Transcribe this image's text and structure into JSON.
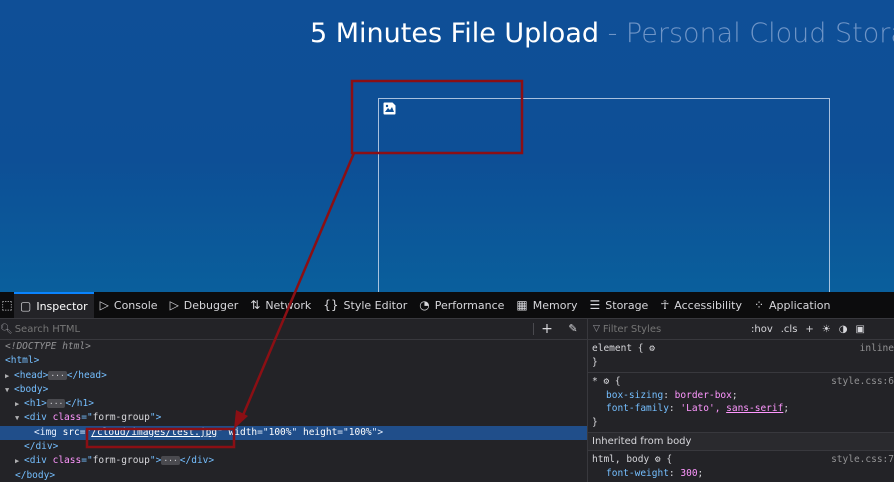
{
  "page": {
    "title_main": "5 Minutes File Upload",
    "title_sep": " - ",
    "title_sub": "Personal Cloud Storage"
  },
  "devtools": {
    "tabs": [
      {
        "label": "Inspector",
        "icon": "inspector-icon"
      },
      {
        "label": "Console",
        "icon": "console-icon"
      },
      {
        "label": "Debugger",
        "icon": "debugger-icon"
      },
      {
        "label": "Network",
        "icon": "network-icon"
      },
      {
        "label": "Style Editor",
        "icon": "style-editor-icon"
      },
      {
        "label": "Performance",
        "icon": "performance-icon"
      },
      {
        "label": "Memory",
        "icon": "memory-icon"
      },
      {
        "label": "Storage",
        "icon": "storage-icon"
      },
      {
        "label": "Accessibility",
        "icon": "accessibility-icon"
      },
      {
        "label": "Application",
        "icon": "application-icon"
      }
    ],
    "search_placeholder": "Search HTML",
    "tree": {
      "doctype": "<!DOCTYPE html>",
      "html_open": "<html>",
      "head_open": "<head>",
      "head_close": "</head>",
      "body_open": "<body>",
      "h1_open": "<h1>",
      "h1_close": "</h1>",
      "div_open_pre": "<div ",
      "class_attr": "class",
      "eq_q": "=\"",
      "form_group": "form-group",
      "close_q_gt": "\">",
      "img_open": "<img ",
      "src_attr": "src",
      "src_value": "/cloud/images/test.jpg",
      "width_attr": "width",
      "width_value": "100%",
      "height_attr": "height",
      "height_value": "100%",
      "quote": "\"",
      "div_close": "</div>",
      "body_close": "</body>"
    },
    "styles": {
      "filter_placeholder": "Filter Styles",
      "hov": ":hov",
      "cls": ".cls",
      "element_selector": "element {",
      "element_close": "}",
      "element_src": "inline",
      "star_selector": "* ",
      "star_open": "{",
      "star_src": "style.css:6",
      "box_sizing_prop": "box-sizing",
      "box_sizing_val": "border-box",
      "font_family_prop": "font-family",
      "font_family_val_1": "'Lato', ",
      "font_family_val_2": "sans-serif",
      "inherited_label": "Inherited from body",
      "html_body_selector": "html, body ",
      "html_body_src": "style.css:7",
      "font_weight_prop": "font-weight",
      "font_weight_val": "300"
    }
  }
}
